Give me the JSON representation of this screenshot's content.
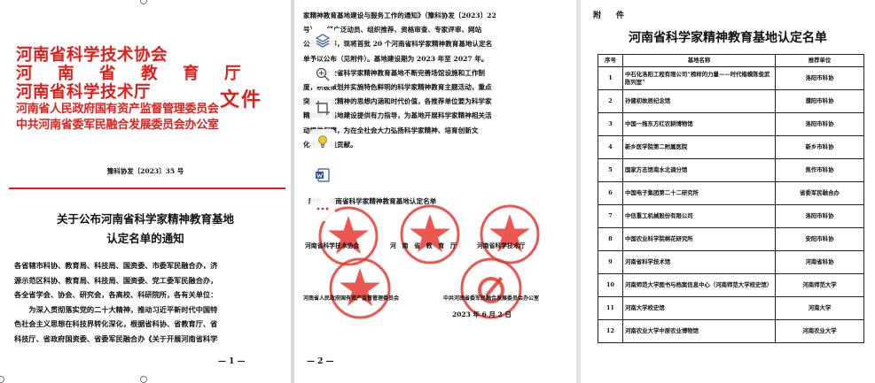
{
  "page1": {
    "header_lines": [
      "河南省科学技术协会",
      "河　南　省　教　育　厅",
      "河南省科学技术厅",
      "河南省人民政府国有资产监督管理委员会",
      "中共河南省委军民融合发展委员会办公室"
    ],
    "wenjian": "文件",
    "doc_number": "豫科协发〔2023〕35 号",
    "title_lines": [
      "关于公布河南省科学家精神教育基地",
      "认定名单的通知"
    ],
    "body_lines": [
      "各省辖市科协、教育局、科技局、国资委、市委军民融合办，济",
      "源示范区科协、教育局、科技局、国资委、党工委军民融合办，",
      "各全省学会、协会、研究会，各高校、科研院所，各有关单位：",
      "　　为深入贯彻落实党的二十大精神，推动习近平新时代中国特",
      "色社会主义思想在科技界转化深化，根据省科协、省教育厅、省",
      "科技厅、省政府国资委、省委军民融合办《关于开展河南省科学"
    ],
    "page_number": "— 1 —"
  },
  "page2": {
    "body_lines": [
      "家精神教育基地建设与服务工作的通知》（豫科协发〔2023〕22",
      "号）　，经广泛动员、组织推荐、资格审查、专家评审、网站",
      "公示等程序，现将首批 20 个河南省科学家精神教育基地认定名",
      "单予以公布（见附件）。基地建设期为 2023 年至 2027 年。",
      "　　希望全省科学家精神教育基地不断完善场馆设施和工作制",
      "度，积极策划并实施特色鲜明的科学家精神教育主题活动，重点",
      "突出科学家精神的思想内涵和时代价值，各推荐单位要为科学家",
      "精神教育基地建设提供有力指导，为基地开展科学家精神相关活",
      "动提供保障，为在全社会大力弘扬科学家精神、培育创新文",
      "化发挥积极贡献。"
    ],
    "attachment_line": "附件：河南省科学家精神教育基地认定名单",
    "seals": [
      {
        "org": "河南省科学技术协会",
        "ring_text": "河南省科学技术协会"
      },
      {
        "org": "河　南　省　教　育　厅",
        "ring_text": "河南省教育厅"
      },
      {
        "org": "河南省科学技术厅",
        "ring_text": "河南省科学技术厅"
      },
      {
        "org": "河南省人民政府国有资产监督管理委员会",
        "ring_text": "河南省人民政府国有资产监督管理委员会"
      },
      {
        "org": "中共河南省委军民融合发展委员会办公室",
        "ring_text": "中共河南省委军民融合发展委员会办公室"
      }
    ],
    "date": "2023 年 6 月 2 日",
    "page_number": "— 2 —"
  },
  "toolbar": {
    "items": [
      {
        "name": "layers",
        "icon": "layers-icon"
      },
      {
        "name": "zoom",
        "icon": "zoom-icon"
      },
      {
        "name": "crop",
        "icon": "crop-icon"
      },
      {
        "name": "ideas",
        "icon": "lightbulb-icon"
      },
      {
        "name": "word",
        "icon": "word-icon"
      },
      {
        "name": "more",
        "icon": "more-icon"
      }
    ]
  },
  "page3": {
    "label": "附　件",
    "title": "河南省科学家精神教育基地认定名单",
    "headers": [
      "序号",
      "基地名称",
      "推荐单位"
    ],
    "rows": [
      [
        "1",
        "中石化洛阳工程有限公司“榜样的力量——时代楷模陈俊武陈列室”",
        "洛阳市科协"
      ],
      [
        "2",
        "孙健初故居纪念馆",
        "濮阳市科协"
      ],
      [
        "3",
        "中国一拖东方红农耕博物馆",
        "洛阳市科协"
      ],
      [
        "4",
        "新乡医学院第二附属医院",
        "新乡市科协"
      ],
      [
        "5",
        "国家方志馆南水北调分馆",
        "焦作市科协"
      ],
      [
        "6",
        "中国电子集团第二十二研究所",
        "省委军民融合办"
      ],
      [
        "7",
        "中信重工机械股份有限公司",
        "洛阳市科协"
      ],
      [
        "8",
        "中国农业科学院棉花研究所",
        "安阳市科协"
      ],
      [
        "9",
        "河南省科学技术馆",
        "河南省科协"
      ],
      [
        "10",
        "河南师范大学图书与档案信息中心（河南师范大学校史馆）",
        "河南师范大学"
      ],
      [
        "11",
        "河南大学校史馆",
        "河南大学"
      ],
      [
        "12",
        "河南农业大学中原农业博物馆",
        "河南农业大学"
      ]
    ]
  },
  "colors": {
    "red": "#e0201c",
    "seal_red": "#e8332b",
    "text": "#111111"
  }
}
